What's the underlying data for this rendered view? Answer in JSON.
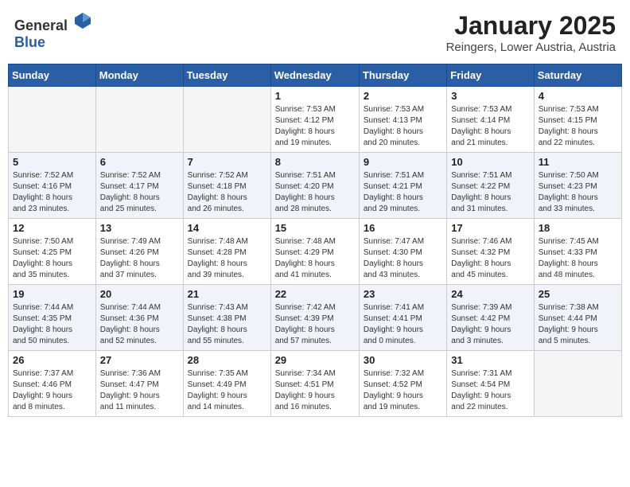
{
  "header": {
    "logo_general": "General",
    "logo_blue": "Blue",
    "month": "January 2025",
    "location": "Reingers, Lower Austria, Austria"
  },
  "weekdays": [
    "Sunday",
    "Monday",
    "Tuesday",
    "Wednesday",
    "Thursday",
    "Friday",
    "Saturday"
  ],
  "weeks": [
    [
      {
        "day": "",
        "info": ""
      },
      {
        "day": "",
        "info": ""
      },
      {
        "day": "",
        "info": ""
      },
      {
        "day": "1",
        "info": "Sunrise: 7:53 AM\nSunset: 4:12 PM\nDaylight: 8 hours\nand 19 minutes."
      },
      {
        "day": "2",
        "info": "Sunrise: 7:53 AM\nSunset: 4:13 PM\nDaylight: 8 hours\nand 20 minutes."
      },
      {
        "day": "3",
        "info": "Sunrise: 7:53 AM\nSunset: 4:14 PM\nDaylight: 8 hours\nand 21 minutes."
      },
      {
        "day": "4",
        "info": "Sunrise: 7:53 AM\nSunset: 4:15 PM\nDaylight: 8 hours\nand 22 minutes."
      }
    ],
    [
      {
        "day": "5",
        "info": "Sunrise: 7:52 AM\nSunset: 4:16 PM\nDaylight: 8 hours\nand 23 minutes."
      },
      {
        "day": "6",
        "info": "Sunrise: 7:52 AM\nSunset: 4:17 PM\nDaylight: 8 hours\nand 25 minutes."
      },
      {
        "day": "7",
        "info": "Sunrise: 7:52 AM\nSunset: 4:18 PM\nDaylight: 8 hours\nand 26 minutes."
      },
      {
        "day": "8",
        "info": "Sunrise: 7:51 AM\nSunset: 4:20 PM\nDaylight: 8 hours\nand 28 minutes."
      },
      {
        "day": "9",
        "info": "Sunrise: 7:51 AM\nSunset: 4:21 PM\nDaylight: 8 hours\nand 29 minutes."
      },
      {
        "day": "10",
        "info": "Sunrise: 7:51 AM\nSunset: 4:22 PM\nDaylight: 8 hours\nand 31 minutes."
      },
      {
        "day": "11",
        "info": "Sunrise: 7:50 AM\nSunset: 4:23 PM\nDaylight: 8 hours\nand 33 minutes."
      }
    ],
    [
      {
        "day": "12",
        "info": "Sunrise: 7:50 AM\nSunset: 4:25 PM\nDaylight: 8 hours\nand 35 minutes."
      },
      {
        "day": "13",
        "info": "Sunrise: 7:49 AM\nSunset: 4:26 PM\nDaylight: 8 hours\nand 37 minutes."
      },
      {
        "day": "14",
        "info": "Sunrise: 7:48 AM\nSunset: 4:28 PM\nDaylight: 8 hours\nand 39 minutes."
      },
      {
        "day": "15",
        "info": "Sunrise: 7:48 AM\nSunset: 4:29 PM\nDaylight: 8 hours\nand 41 minutes."
      },
      {
        "day": "16",
        "info": "Sunrise: 7:47 AM\nSunset: 4:30 PM\nDaylight: 8 hours\nand 43 minutes."
      },
      {
        "day": "17",
        "info": "Sunrise: 7:46 AM\nSunset: 4:32 PM\nDaylight: 8 hours\nand 45 minutes."
      },
      {
        "day": "18",
        "info": "Sunrise: 7:45 AM\nSunset: 4:33 PM\nDaylight: 8 hours\nand 48 minutes."
      }
    ],
    [
      {
        "day": "19",
        "info": "Sunrise: 7:44 AM\nSunset: 4:35 PM\nDaylight: 8 hours\nand 50 minutes."
      },
      {
        "day": "20",
        "info": "Sunrise: 7:44 AM\nSunset: 4:36 PM\nDaylight: 8 hours\nand 52 minutes."
      },
      {
        "day": "21",
        "info": "Sunrise: 7:43 AM\nSunset: 4:38 PM\nDaylight: 8 hours\nand 55 minutes."
      },
      {
        "day": "22",
        "info": "Sunrise: 7:42 AM\nSunset: 4:39 PM\nDaylight: 8 hours\nand 57 minutes."
      },
      {
        "day": "23",
        "info": "Sunrise: 7:41 AM\nSunset: 4:41 PM\nDaylight: 9 hours\nand 0 minutes."
      },
      {
        "day": "24",
        "info": "Sunrise: 7:39 AM\nSunset: 4:42 PM\nDaylight: 9 hours\nand 3 minutes."
      },
      {
        "day": "25",
        "info": "Sunrise: 7:38 AM\nSunset: 4:44 PM\nDaylight: 9 hours\nand 5 minutes."
      }
    ],
    [
      {
        "day": "26",
        "info": "Sunrise: 7:37 AM\nSunset: 4:46 PM\nDaylight: 9 hours\nand 8 minutes."
      },
      {
        "day": "27",
        "info": "Sunrise: 7:36 AM\nSunset: 4:47 PM\nDaylight: 9 hours\nand 11 minutes."
      },
      {
        "day": "28",
        "info": "Sunrise: 7:35 AM\nSunset: 4:49 PM\nDaylight: 9 hours\nand 14 minutes."
      },
      {
        "day": "29",
        "info": "Sunrise: 7:34 AM\nSunset: 4:51 PM\nDaylight: 9 hours\nand 16 minutes."
      },
      {
        "day": "30",
        "info": "Sunrise: 7:32 AM\nSunset: 4:52 PM\nDaylight: 9 hours\nand 19 minutes."
      },
      {
        "day": "31",
        "info": "Sunrise: 7:31 AM\nSunset: 4:54 PM\nDaylight: 9 hours\nand 22 minutes."
      },
      {
        "day": "",
        "info": ""
      }
    ]
  ]
}
